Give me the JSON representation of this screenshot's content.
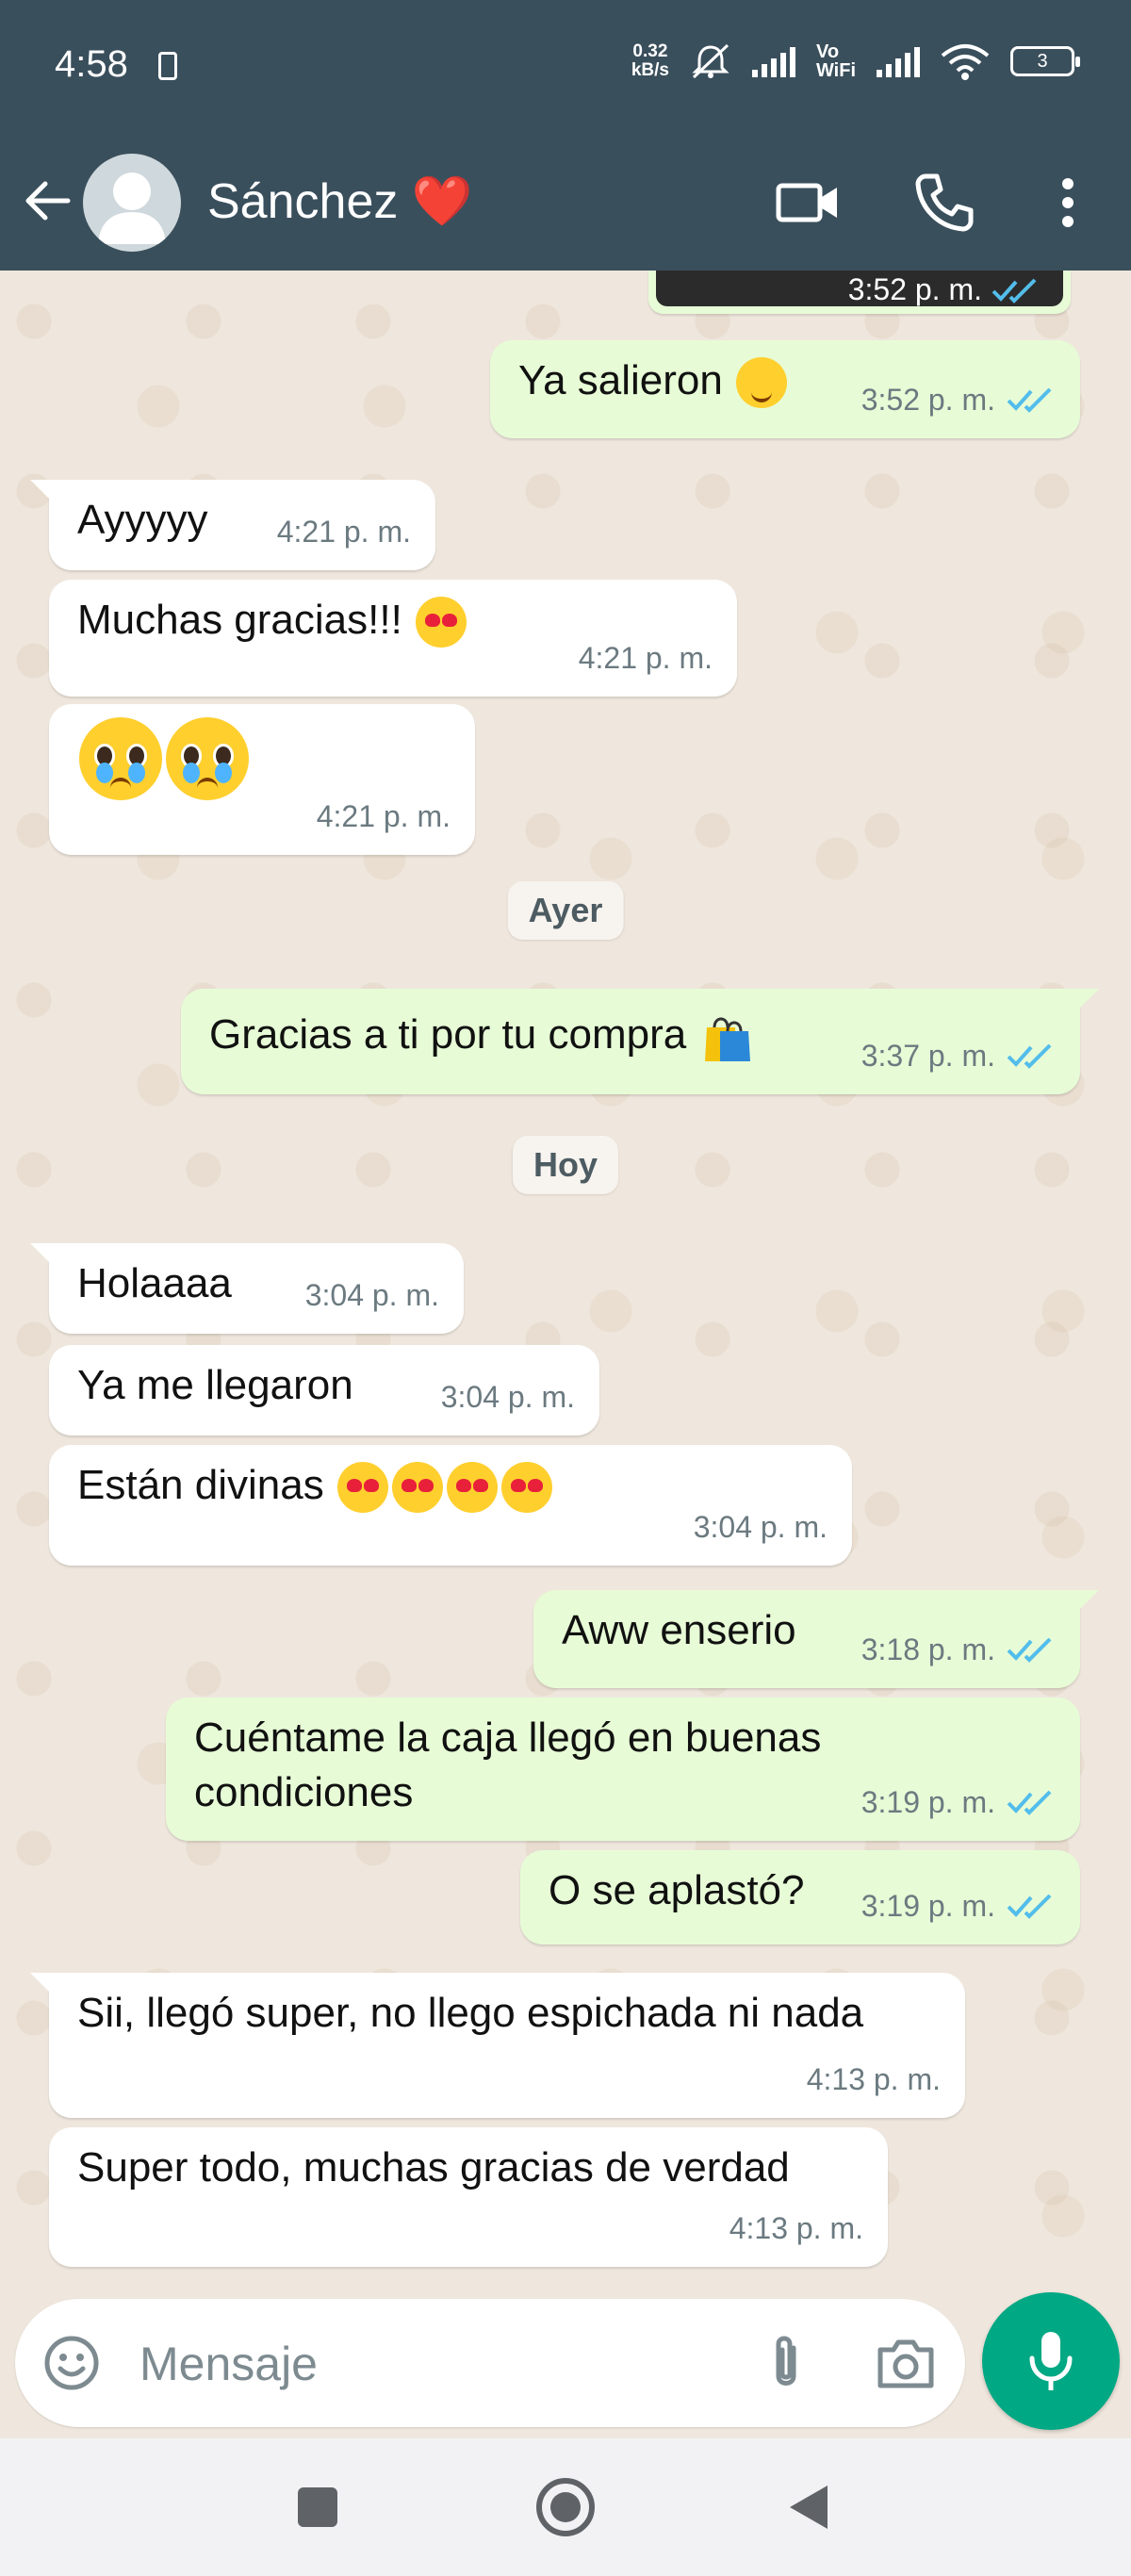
{
  "status_bar": {
    "time": "4:58",
    "net_speed_value": "0.32",
    "net_speed_unit": "kB/s",
    "vowifi_line1": "Vo",
    "vowifi_line2": "WiFi",
    "battery_level": "3",
    "icons": [
      "battery-saver-icon",
      "mute-icon",
      "signal-icon",
      "wifi-icon",
      "battery-icon"
    ]
  },
  "header": {
    "contact_name": "Sánchez ❤️",
    "icons": [
      "back-arrow-icon",
      "avatar-icon",
      "video-call-icon",
      "voice-call-icon",
      "more-options-icon"
    ]
  },
  "chat": {
    "image_message_time": "3:52 p. m.",
    "messages": [
      {
        "dir": "out",
        "text": "Ya salieron",
        "time": "3:52 p. m."
      },
      {
        "dir": "in",
        "text": "Ayyyyy",
        "time": "4:21 p. m."
      },
      {
        "dir": "in",
        "text": "Muchas gracias!!!",
        "time": "4:21 p. m."
      },
      {
        "dir": "in",
        "text": "",
        "time": "4:21 p. m."
      },
      {
        "dir": "out",
        "text": "Gracias a ti por tu compra",
        "time": "3:37 p. m."
      },
      {
        "dir": "in",
        "text": "Holaaaa",
        "time": "3:04 p. m."
      },
      {
        "dir": "in",
        "text": "Ya me llegaron",
        "time": "3:04 p. m."
      },
      {
        "dir": "in",
        "text": "Están divinas",
        "time": "3:04 p. m."
      },
      {
        "dir": "out",
        "text": "Aww enserio",
        "time": "3:18 p. m."
      },
      {
        "dir": "out",
        "text": "Cuéntame la caja llegó en buenas condiciones",
        "time": "3:19 p. m."
      },
      {
        "dir": "out",
        "text": "O se aplastó?",
        "time": "3:19 p. m."
      },
      {
        "dir": "in",
        "text": "Sii, llegó super, no llego espichada ni nada",
        "time": "4:13 p. m."
      },
      {
        "dir": "in",
        "text": "Super todo, muchas gracias de verdad",
        "time": "4:13 p. m."
      }
    ],
    "date_chips": [
      "Ayer",
      "Hoy"
    ]
  },
  "composer": {
    "placeholder": "Mensaje",
    "icons": [
      "emoji-icon",
      "attach-icon",
      "camera-icon",
      "mic-icon"
    ]
  },
  "colors": {
    "header_bg": "#3a4f5c",
    "outgoing_bubble": "#e7fcd6",
    "incoming_bubble": "#ffffff",
    "chat_bg": "#efe7dd",
    "read_ticks": "#53bdeb",
    "accent_green": "#00a884"
  }
}
